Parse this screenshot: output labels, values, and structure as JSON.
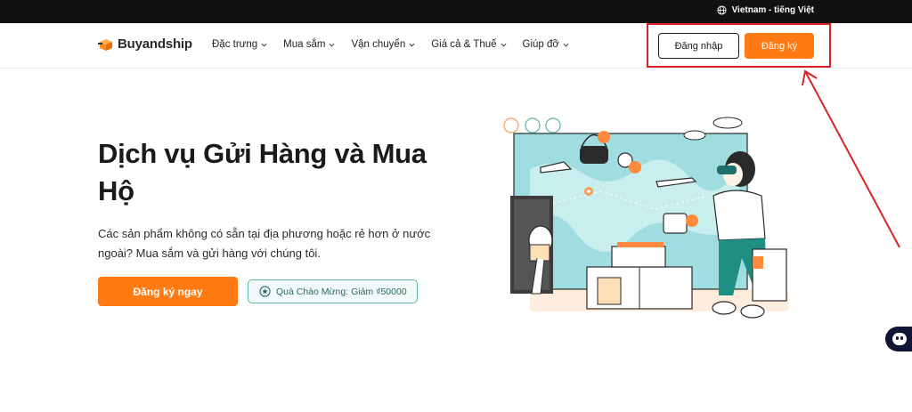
{
  "topbar": {
    "language_label": "Vietnam - tiếng Việt"
  },
  "header": {
    "logo_text": "Buyandship",
    "nav": [
      {
        "label": "Đặc trưng"
      },
      {
        "label": "Mua sắm"
      },
      {
        "label": "Vận chuyển"
      },
      {
        "label": "Giá cả & Thuế"
      },
      {
        "label": "Giúp đỡ"
      }
    ],
    "login_label": "Đăng nhập",
    "signup_label": "Đăng ký"
  },
  "hero": {
    "title": "Dịch vụ Gửi Hàng và Mua Hộ",
    "description": "Các sản phẩm không có sẵn tại địa phương hoặc rẻ hơn ở nước ngoài? Mua sắm và gửi hàng với chúng tôi.",
    "cta_label": "Đăng ký ngay",
    "promo_label": "Quà Chào Mừng: Giảm ₫50000"
  },
  "colors": {
    "brand_orange": "#ff7a13",
    "topbar_bg": "#111111",
    "annotation_red": "#d8232a",
    "promo_teal": "#5fb5a5"
  },
  "icons": {
    "language": "globe-icon",
    "nav_chevron": "chevron-down-icon",
    "promo": "star-badge-icon",
    "chat": "chatbot-icon"
  }
}
